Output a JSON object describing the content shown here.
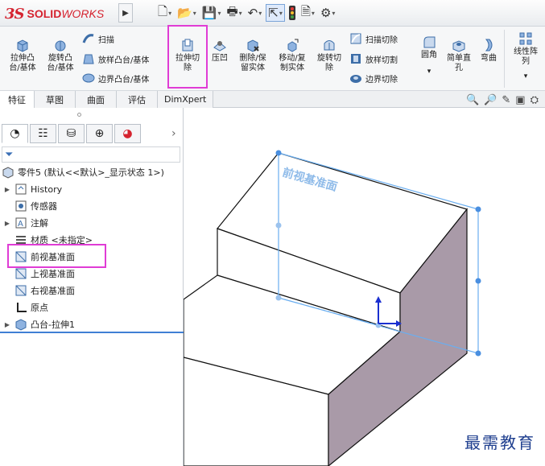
{
  "app": {
    "logo_ds": "3S",
    "logo_solid": "SOLID",
    "logo_works": "WORKS",
    "expand_glyph": "▶"
  },
  "quick_access": [
    {
      "name": "new-document-icon",
      "glyph": "🗋",
      "dropdown": "▾"
    },
    {
      "name": "open-icon",
      "glyph": "📂",
      "dropdown": "▾"
    },
    {
      "name": "save-icon",
      "glyph": "💾",
      "dropdown": "▾"
    },
    {
      "name": "print-icon",
      "glyph": "🖶",
      "dropdown": "▾"
    },
    {
      "name": "undo-icon",
      "glyph": "↶",
      "dropdown": "▾"
    },
    {
      "name": "select-icon",
      "glyph": "⇱",
      "dropdown": "▾"
    },
    {
      "name": "rebuild-icon",
      "glyph": "🚦",
      "dropdown": ""
    },
    {
      "name": "file-properties-icon",
      "glyph": "🗎",
      "dropdown": "▾"
    },
    {
      "name": "options-icon",
      "glyph": "⚙",
      "dropdown": "▾"
    }
  ],
  "ribbon": {
    "extrude_boss": "拉伸凸\n台/基体",
    "revolve_boss": "旋转凸\n台/基体",
    "sweep": "扫描",
    "loft_boss": "放样凸台/基体",
    "boundary_boss": "边界凸台/基体",
    "extrude_cut": "拉伸切\n除",
    "indent": "压凹",
    "delete_keep_body": "删除/保\n留实体",
    "move_copy_body": "移动/复\n制实体",
    "revolve_cut": "旋转切\n除",
    "swept_cut": "扫描切除",
    "lofted_cut": "放样切割",
    "boundary_cut": "边界切除",
    "fillet": "圆角",
    "simple_hole": "简单直\n孔",
    "flex": "弯曲",
    "linear_pattern": "线性阵\n列",
    "dropdown": "▾"
  },
  "tabs": [
    "特征",
    "草图",
    "曲面",
    "评估",
    "DimXpert"
  ],
  "fm_tabs": [
    "◔",
    "☷",
    "⛁",
    "⊕",
    "◕"
  ],
  "fm_chevron": "›",
  "filter_glyph": "⏷",
  "tree": {
    "part": "零件5 (默认<<默认>_显示状态 1>)",
    "history": "History",
    "sensors": "传感器",
    "annotations": "注解",
    "material": "材质 <未指定>",
    "front_plane": "前视基准面",
    "top_plane": "上视基准面",
    "right_plane": "右视基准面",
    "origin": "原点",
    "boss_extrude": "凸台-拉伸1"
  },
  "viewport": {
    "plane_label": "前视基准面",
    "watermark": "最需教育"
  },
  "view_tools": [
    "🔍",
    "🔎",
    "✎",
    "▣",
    "⛭"
  ],
  "colors": {
    "highlight": "#e03cd5",
    "plane": "#6aaef0",
    "side_face": "#a99aa8",
    "accent_red": "#d5232f"
  }
}
